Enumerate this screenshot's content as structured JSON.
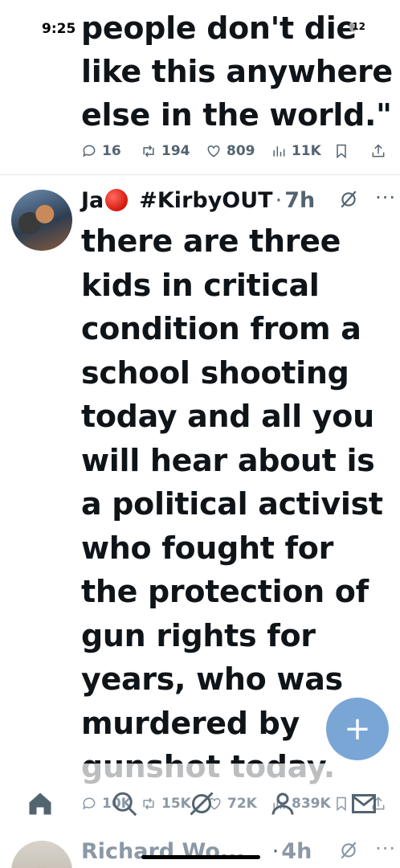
{
  "status_bar": {
    "time": "9:25",
    "right_text": "12"
  },
  "tweet1": {
    "text": "people don't die like this anywhere else in the world.\"",
    "replies": "16",
    "reposts": "194",
    "likes": "809",
    "views": "11K"
  },
  "tweet2": {
    "author_name": "Ja",
    "hashtag": "#KirbyOUT",
    "separator": "·",
    "time": "7h",
    "more": "···",
    "text": "there are three kids in critical condition from a school shooting today and all you will hear about is a political activist who fought for the protection of gun rights for years, who was murdered by gunshot today.",
    "replies": "10K",
    "reposts": "15K",
    "likes": "72K",
    "views": "839K"
  },
  "tweet3": {
    "author_name": "Richard Wo...",
    "separator": "·",
    "time": "4h",
    "more": "···"
  },
  "fab": {
    "label": "+"
  },
  "icons": {
    "reply": "reply-icon",
    "repost": "repost-icon",
    "like": "heart-icon",
    "views": "views-icon",
    "bookmark": "bookmark-icon",
    "share": "share-icon",
    "grok": "grok-icon",
    "home": "home-icon",
    "search": "search-icon",
    "grok_tab": "grok-icon",
    "communities": "people-icon",
    "messages": "envelope-icon"
  },
  "colors": {
    "text": "#0f1419",
    "muted": "#536471",
    "fab": "#7aa6d6",
    "red_emoji": "#d3180c"
  }
}
